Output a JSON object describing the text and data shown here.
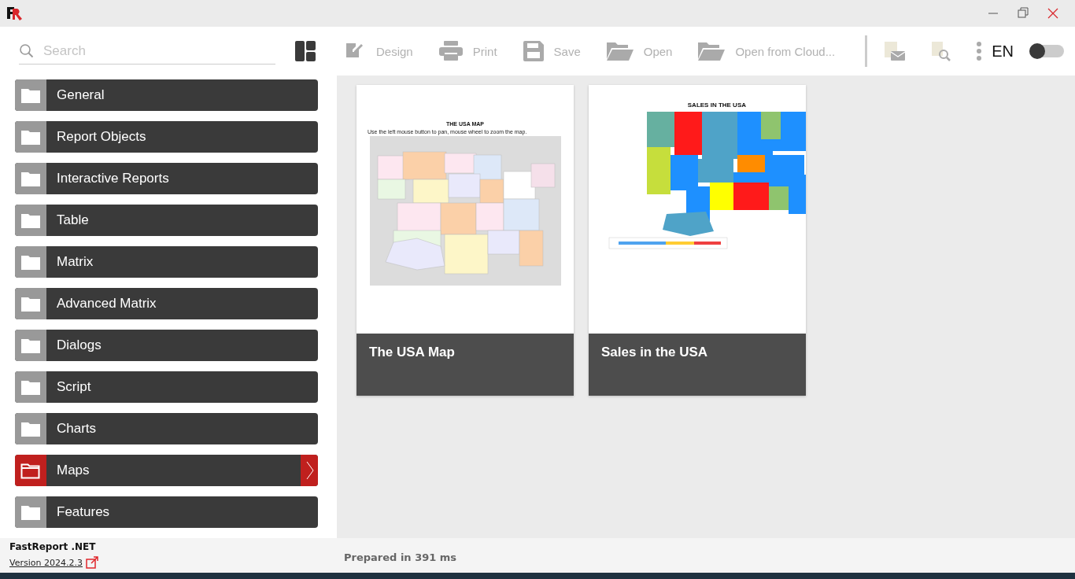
{
  "search": {
    "placeholder": "Search"
  },
  "toolbar": [
    {
      "label": "Design",
      "kind": "design",
      "disabled": true
    },
    {
      "label": "Print",
      "kind": "print",
      "disabled": true
    },
    {
      "label": "Save",
      "kind": "save",
      "disabled": true
    },
    {
      "label": "Open",
      "kind": "open",
      "disabled": true
    },
    {
      "label": "Open from Cloud...",
      "kind": "open",
      "disabled": true
    }
  ],
  "language": "EN",
  "theme_toggle": {
    "on": false
  },
  "categories": [
    {
      "label": "General",
      "selected": false
    },
    {
      "label": "Report Objects",
      "selected": false
    },
    {
      "label": "Interactive Reports",
      "selected": false
    },
    {
      "label": "Table",
      "selected": false
    },
    {
      "label": "Matrix",
      "selected": false
    },
    {
      "label": "Advanced Matrix",
      "selected": false
    },
    {
      "label": "Dialogs",
      "selected": false
    },
    {
      "label": "Script",
      "selected": false
    },
    {
      "label": "Charts",
      "selected": false
    },
    {
      "label": "Maps",
      "selected": true
    },
    {
      "label": "Features",
      "selected": false
    }
  ],
  "reports": [
    {
      "title": "The USA Map",
      "heading": "THE USA MAP",
      "note": "Use the left mouse button to pan, mouse wheel to zoom the map.",
      "kind": "plain"
    },
    {
      "title": "Sales in the USA",
      "heading": "SALES IN THE USA",
      "kind": "sales"
    }
  ],
  "footer": {
    "product": "FastReport .NET",
    "version": "Version 2024.2.3",
    "status": "Prepared in 391 ms"
  }
}
